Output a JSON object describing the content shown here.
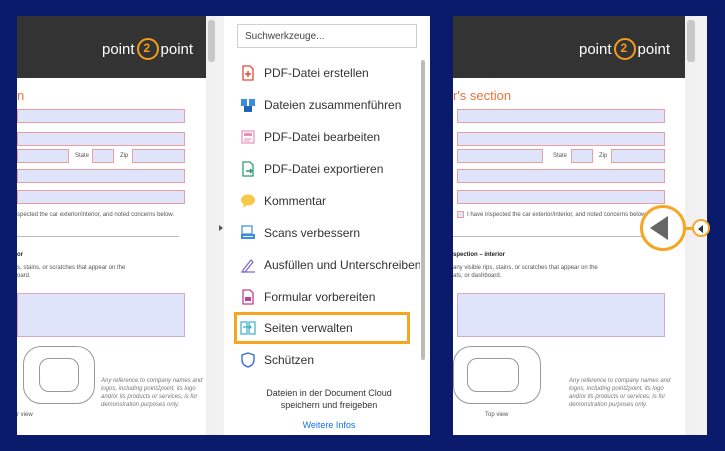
{
  "left_doc": {
    "logo_left": "point",
    "logo_right": "point",
    "section_title": "n",
    "state_label": "State",
    "zip_label": "Zip",
    "inspected_text": "spected the car exterior/interior, and noted concerns below.",
    "inspection_heading": "or",
    "inspection_text_1": "s, stains, or scratches that appear on the",
    "inspection_text_2": "oard.",
    "disclaimer_1": "Any reference to company names and",
    "disclaimer_2": "logos, including point2point, its logo",
    "disclaimer_3": "and/or its products or services, is for",
    "disclaimer_4": "demonstration purposes only.",
    "view_label": "r view"
  },
  "tools_panel": {
    "search_placeholder": "Suchwerkzeuge...",
    "items": [
      {
        "label": "PDF-Datei erstellen",
        "icon": "create-pdf-icon"
      },
      {
        "label": "Dateien zusammenführen",
        "icon": "combine-files-icon"
      },
      {
        "label": "PDF-Datei bearbeiten",
        "icon": "edit-pdf-icon"
      },
      {
        "label": "PDF-Datei exportieren",
        "icon": "export-pdf-icon"
      },
      {
        "label": "Kommentar",
        "icon": "comment-icon"
      },
      {
        "label": "Scans verbessern",
        "icon": "enhance-scans-icon"
      },
      {
        "label": "Ausfüllen und Unterschreiben",
        "icon": "fill-sign-icon"
      },
      {
        "label": "Formular vorbereiten",
        "icon": "prepare-form-icon"
      },
      {
        "label": "Seiten verwalten",
        "icon": "organize-pages-icon"
      },
      {
        "label": "Schützen",
        "icon": "protect-icon"
      }
    ],
    "cloud_text_1": "Dateien in der Document Cloud",
    "cloud_text_2": "speichern und freigeben",
    "cloud_link": "Weitere Infos"
  },
  "right_doc": {
    "logo_left": "point",
    "logo_right": "point",
    "section_title": "r's section",
    "state_label": "State",
    "zip_label": "Zip",
    "inspected_text": "I have inspected the car exterior/interior, and noted concerns below.",
    "inspection_heading": "spection – interior",
    "inspection_text_1": "any visible rips, stains, or scratches that appear on the",
    "inspection_text_2": "ats, or dashboard.",
    "disclaimer_1": "Any reference to company names and",
    "disclaimer_2": "logos, including point2point, its logo",
    "disclaimer_3": "and/or its products or services, is for",
    "disclaimer_4": "demonstration purposes only.",
    "view_label": "Top view"
  },
  "colors": {
    "background": "#0b1b6b",
    "accent": "#f5a623",
    "section_title": "#e8743b",
    "link": "#1473e6"
  }
}
